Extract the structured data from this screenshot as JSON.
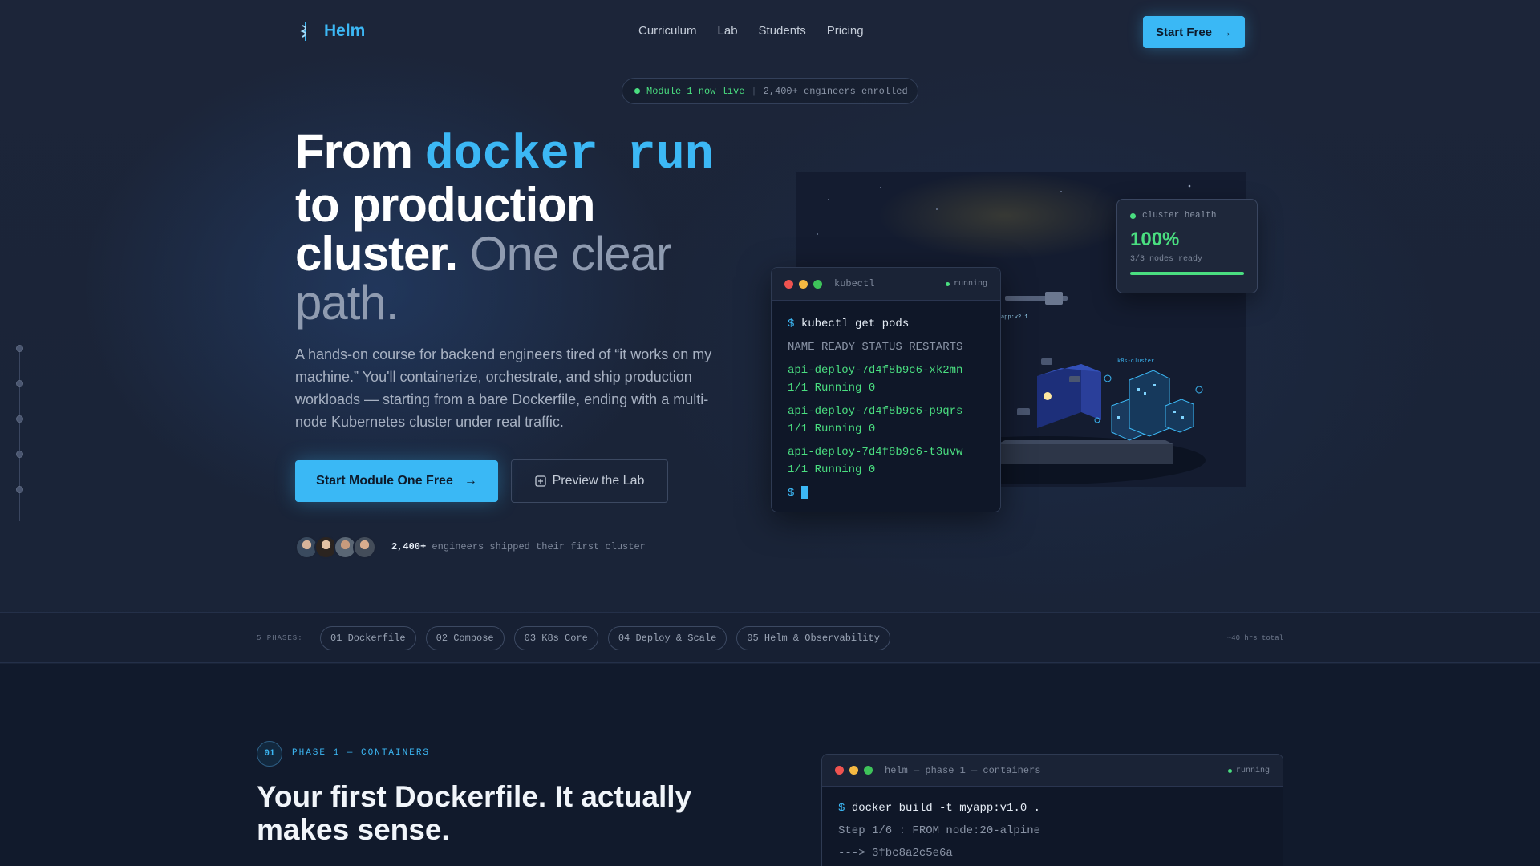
{
  "brand": {
    "name": "Helm"
  },
  "nav": {
    "links": [
      "Curriculum",
      "Lab",
      "Students",
      "Pricing"
    ],
    "cta_label": "Start Free"
  },
  "badge": {
    "live": "Module 1 now live",
    "enrolled": "2,400+ engineers enrolled"
  },
  "hero": {
    "title_part1": "From ",
    "title_code": "docker run",
    "title_part2": "to production cluster.",
    "title_muted": " One clear path.",
    "description": "A hands-on course for backend engineers tired of “it works on my machine.” You'll containerize, orchestrate, and ship production workloads — starting from a bare Dockerfile, ending with a multi-node Kubernetes cluster under real traffic.",
    "primary_button": "Start Module One Free",
    "secondary_button": "Preview the Lab",
    "social_count": "2,400+",
    "social_text": " engineers shipped their first cluster"
  },
  "terminal": {
    "title": "kubectl",
    "status": "running",
    "prompt": "$",
    "command": "kubectl get pods",
    "header": "NAME READY STATUS RESTARTS",
    "pods": [
      {
        "name": "api-deploy-7d4f8b9c6-xk2mn",
        "status": "1/1 Running 0"
      },
      {
        "name": "api-deploy-7d4f8b9c6-p9qrs",
        "status": "1/1 Running 0"
      },
      {
        "name": "api-deploy-7d4f8b9c6-t3uvw",
        "status": "1/1 Running 0"
      }
    ]
  },
  "health": {
    "label": "cluster health",
    "value": "100%",
    "sub": "3/3 nodes ready",
    "fill": 1.0
  },
  "scene": {
    "label_app": "app:v2.1",
    "label_cluster": "k8s-cluster"
  },
  "phases": {
    "label": "5 PHASES:",
    "items": [
      "01 Dockerfile",
      "02 Compose",
      "03 K8s Core",
      "04 Deploy & Scale",
      "05 Helm & Observability"
    ],
    "total": "~40 hrs total"
  },
  "phase1": {
    "number": "01",
    "kicker": "PHASE 1 — CONTAINERS",
    "title": "Your first Dockerfile. It actually makes sense.",
    "terminal_title": "helm — phase 1 — containers",
    "terminal_status": "running",
    "prompt": "$",
    "command": "docker build -t myapp:v1.0 .",
    "lines": [
      "Step 1/6 : FROM node:20-alpine",
      "---> 3fbc8a2c5e6a"
    ]
  },
  "colors": {
    "accent": "#3ab8f5",
    "success": "#4ade80",
    "background": "#1a2336"
  }
}
